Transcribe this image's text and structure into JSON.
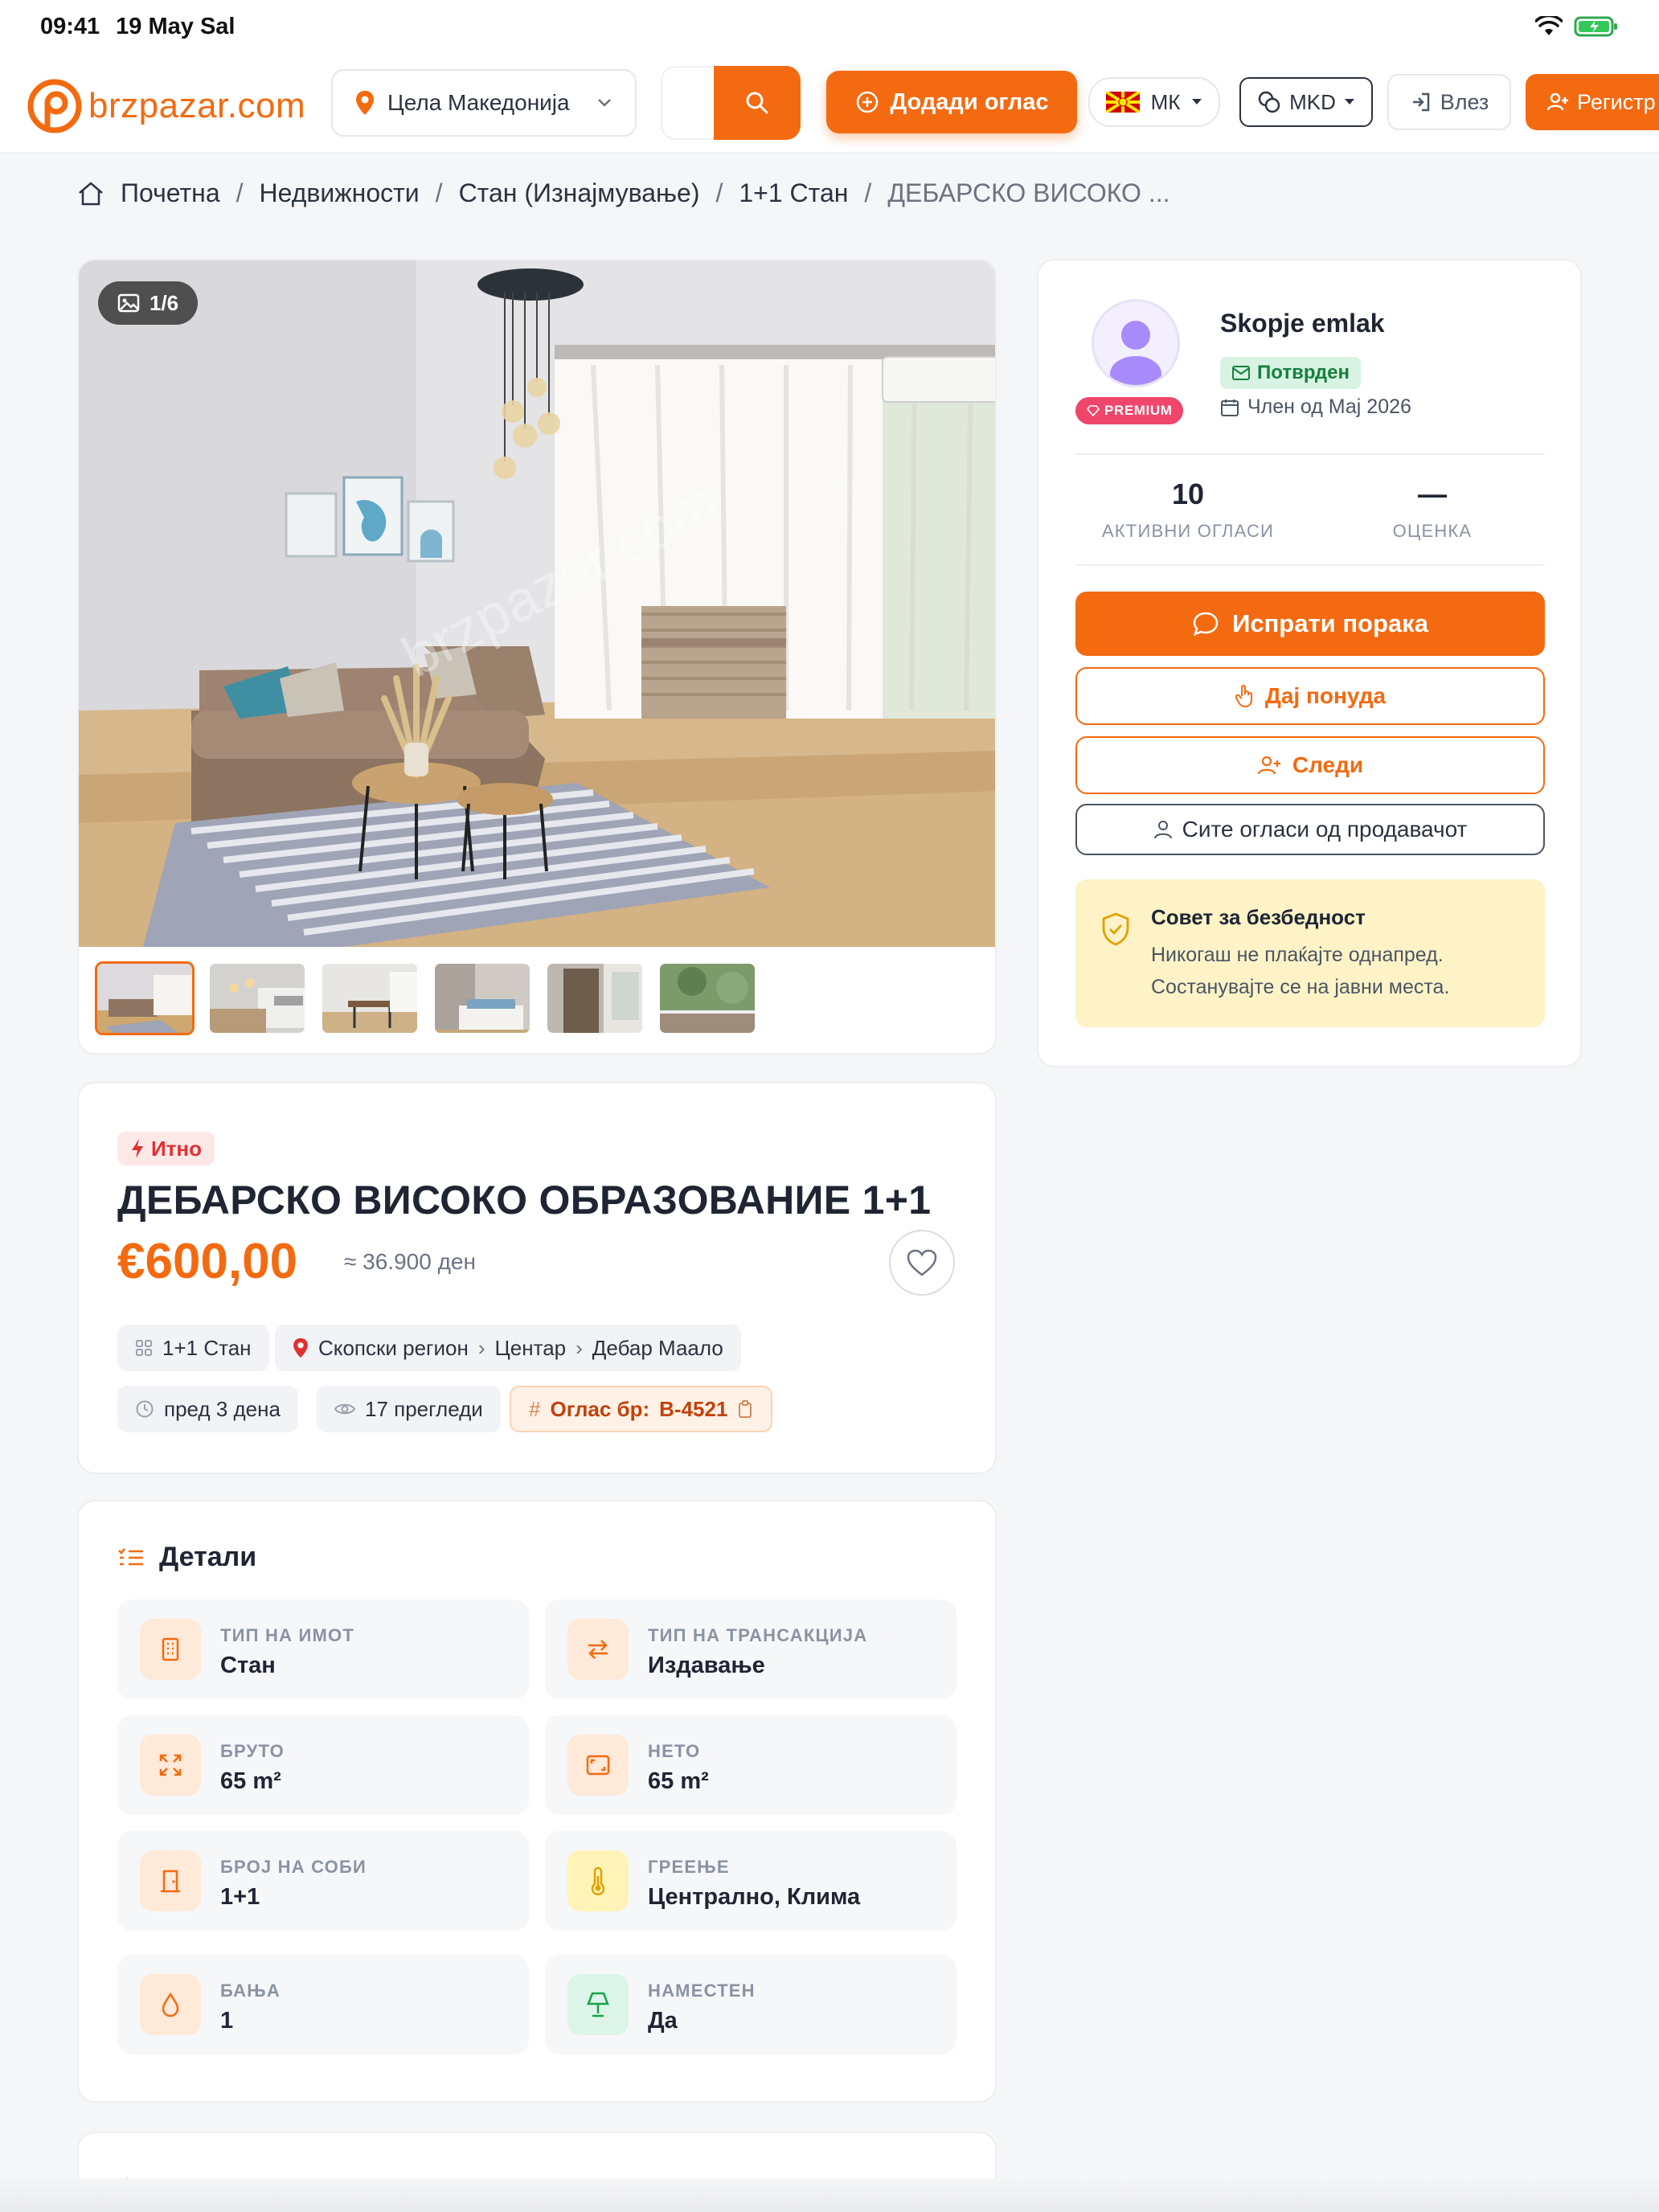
{
  "status_bar": {
    "time": "09:41",
    "date": "19 May Sal"
  },
  "header": {
    "logo_text": "brzpazar.com",
    "location": "Цела Македонија",
    "add_listing": "Додади оглас",
    "language": "МК",
    "currency": "MKD",
    "login": "Влез",
    "register": "Регистр"
  },
  "breadcrumb": [
    "Почетна",
    "Недвижности",
    "Стан (Изнајмување)",
    "1+1 Стан",
    "ДЕБАРСКО ВИСОКО ..."
  ],
  "gallery": {
    "counter": "1/6",
    "watermark": "brzpazar.com",
    "thumb_count": 6
  },
  "listing": {
    "badge": "Итно",
    "title": "ДЕБАРСКО ВИСОКО ОБРАЗОВАНИЕ 1+1",
    "price": "€600,00",
    "price_alt": "≈ 36.900 ден",
    "category": "1+1 Стан",
    "region": "Скопски регион",
    "municipality": "Центар",
    "neighborhood": "Дебар Маало",
    "posted": "пред 3 дена",
    "views": "17 прегледи",
    "ad_number_label": "Оглас бр:",
    "ad_number": "B-4521"
  },
  "details": {
    "title": "Детали",
    "items": [
      {
        "label": "ТИП НА ИМОТ",
        "value": "Стан",
        "icon": "building-icon"
      },
      {
        "label": "ТИП НА ТРАНСАКЦИЈА",
        "value": "Издавање",
        "icon": "swap-icon"
      },
      {
        "label": "БРУТО",
        "value": "65 m²",
        "icon": "expand-icon"
      },
      {
        "label": "НЕТО",
        "value": "65 m²",
        "icon": "area-icon"
      },
      {
        "label": "БРОЈ НА СОБИ",
        "value": "1+1",
        "icon": "door-icon"
      },
      {
        "label": "ГРЕЕЊЕ",
        "value": "Централно, Клима",
        "icon": "thermometer-icon"
      },
      {
        "label": "БАЊА",
        "value": "1",
        "icon": "drop-icon"
      },
      {
        "label": "НАМЕСТЕН",
        "value": "Да",
        "icon": "lamp-icon"
      }
    ]
  },
  "seller": {
    "name": "Skopje emlak",
    "premium": "PREMIUM",
    "verified": "Потврден",
    "member_since": "Член од Мај 2026",
    "active_ads": "10",
    "active_ads_label": "АКТИВНИ ОГЛАСИ",
    "rating": "—",
    "rating_label": "ОЦЕНКА",
    "send_message": "Испрати порака",
    "make_offer": "Дај понуда",
    "follow": "Следи",
    "all_ads": "Сите огласи од продавачот",
    "safety_title": "Совет за безбедност",
    "safety_line1": "Никогаш не плаќајте однапред.",
    "safety_line2": "Состанувајте се на јавни места."
  },
  "colors": {
    "accent": "#f46a10",
    "urgent": "#e03131",
    "verified": "#15803d",
    "premium": "#f0466b"
  }
}
